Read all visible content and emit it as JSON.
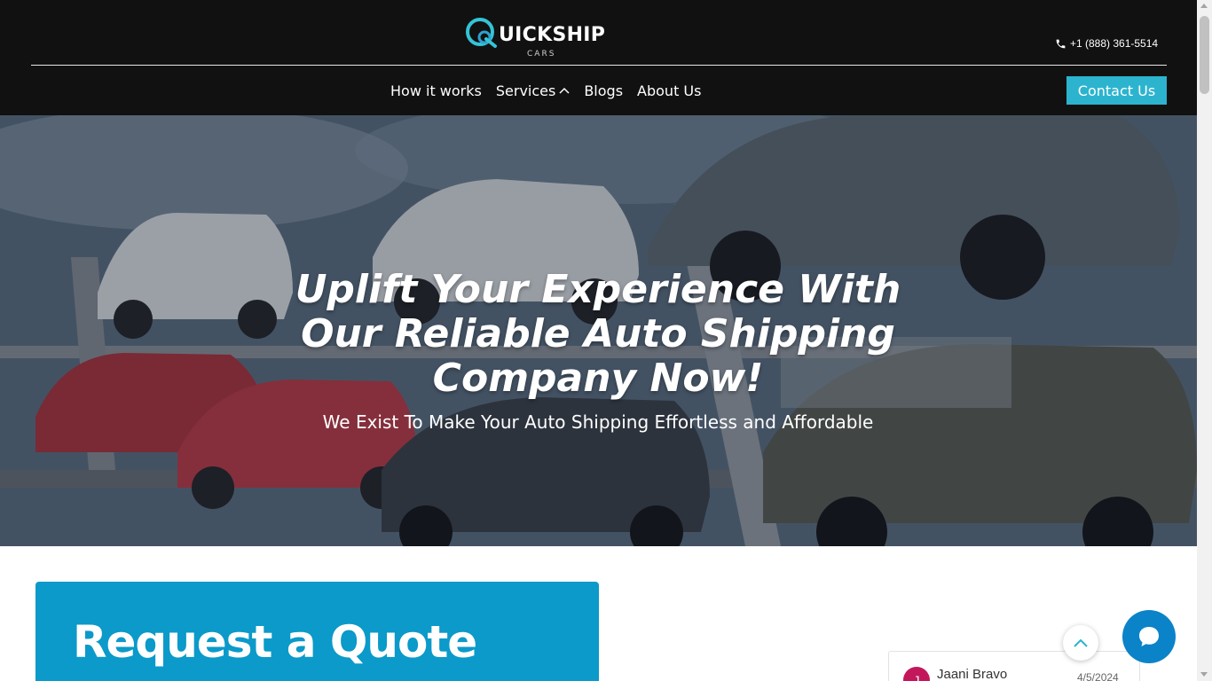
{
  "header": {
    "logo_text": "UICKSHIP",
    "logo_subtext": "CARS",
    "phone": "+1 (888) 361-5514",
    "phone_icon": "phone-icon",
    "nav": [
      {
        "label": "How it works"
      },
      {
        "label": "Services",
        "icon": "chevron-up-icon"
      },
      {
        "label": "Blogs"
      },
      {
        "label": "About Us"
      }
    ],
    "contact_button": "Contact Us"
  },
  "hero": {
    "title_line1": "Uplift Your Experience With",
    "title_line2": "Our Reliable Auto Shipping",
    "title_line3": "Company Now!",
    "subtitle": "We Exist To Make Your Auto Shipping Effortless and Affordable"
  },
  "quote": {
    "title": "Request a Quote"
  },
  "review": {
    "avatar_initial": "J",
    "name": "Jaani Bravo",
    "date": "4/5/2024"
  },
  "widgets": {
    "scroll_top_icon": "chevron-up-icon",
    "chat_icon": "chat-bubble-icon"
  },
  "colors": {
    "header_bg": "#111111",
    "accent": "#2cb4cf",
    "quote_bg": "#0b9ac9",
    "chat_bg": "#0b83c9",
    "logo_teal": "#35c3d6"
  }
}
